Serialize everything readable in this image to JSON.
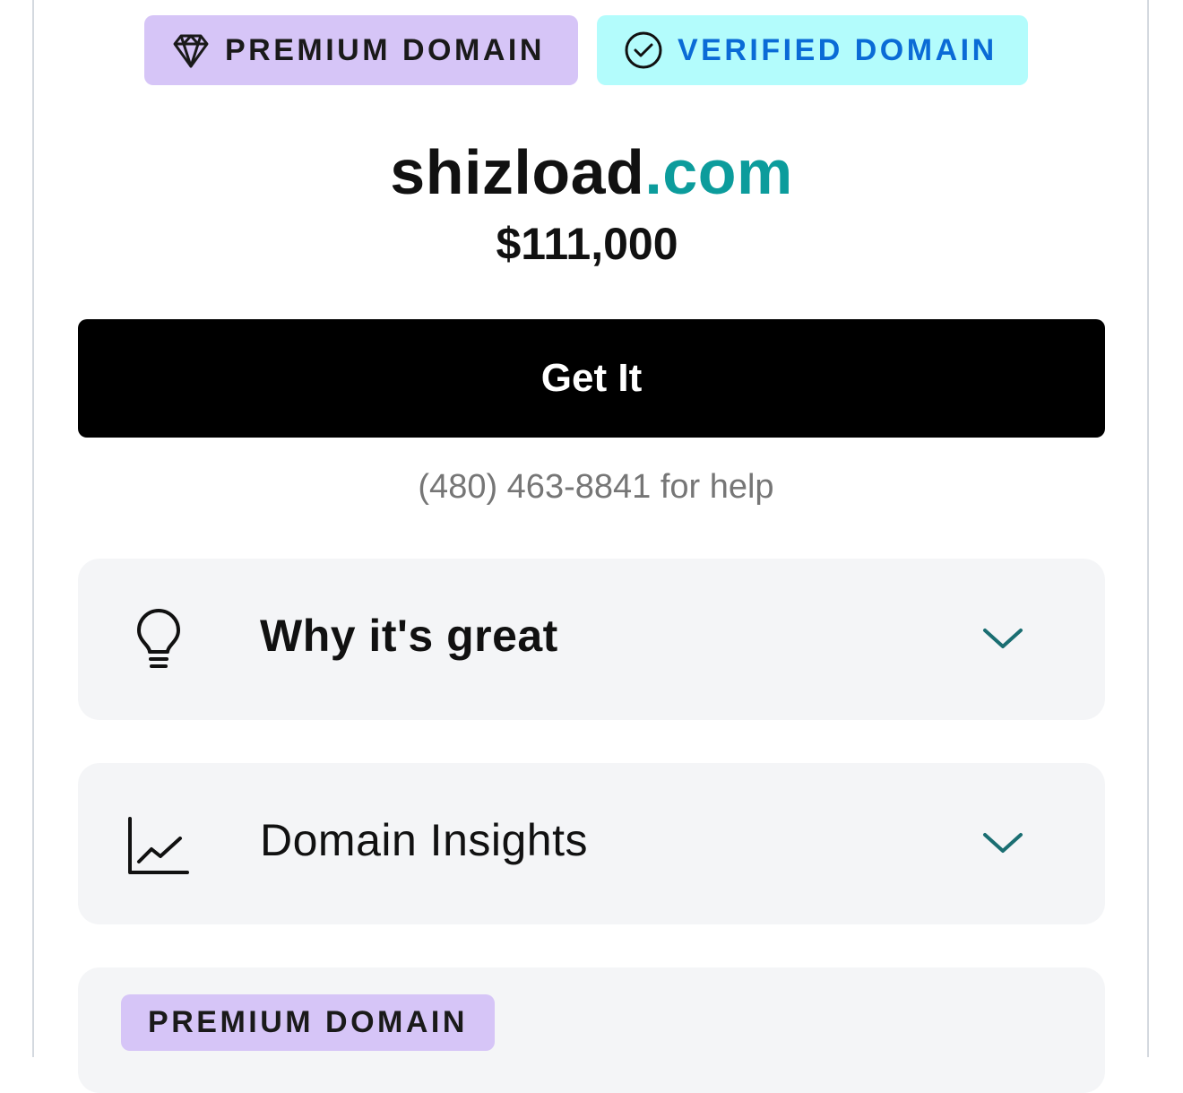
{
  "badges": {
    "premium": {
      "label": "PREMIUM DOMAIN",
      "icon": "diamond-icon",
      "background": "#d6c5f7",
      "color": "#1a1a1a"
    },
    "verified": {
      "label": "VERIFIED DOMAIN",
      "icon": "check-circle-icon",
      "background": "#b3fcfc",
      "color": "#0a6bd6"
    }
  },
  "domain": {
    "name": "shizload",
    "tld": ".com",
    "tld_color": "#0c9c9c"
  },
  "price": "$111,000",
  "cta": {
    "label": "Get It"
  },
  "help": {
    "text": "(480) 463-8841 for help"
  },
  "accordions": [
    {
      "label": "Why it's great",
      "icon": "lightbulb-icon"
    },
    {
      "label": "Domain Insights",
      "icon": "line-chart-icon"
    }
  ],
  "bottom_card": {
    "badge_label": "PREMIUM DOMAIN"
  },
  "colors": {
    "accent": "#0c9c9c",
    "chevron": "#1a6e72",
    "card_bg": "#f4f5f7"
  }
}
